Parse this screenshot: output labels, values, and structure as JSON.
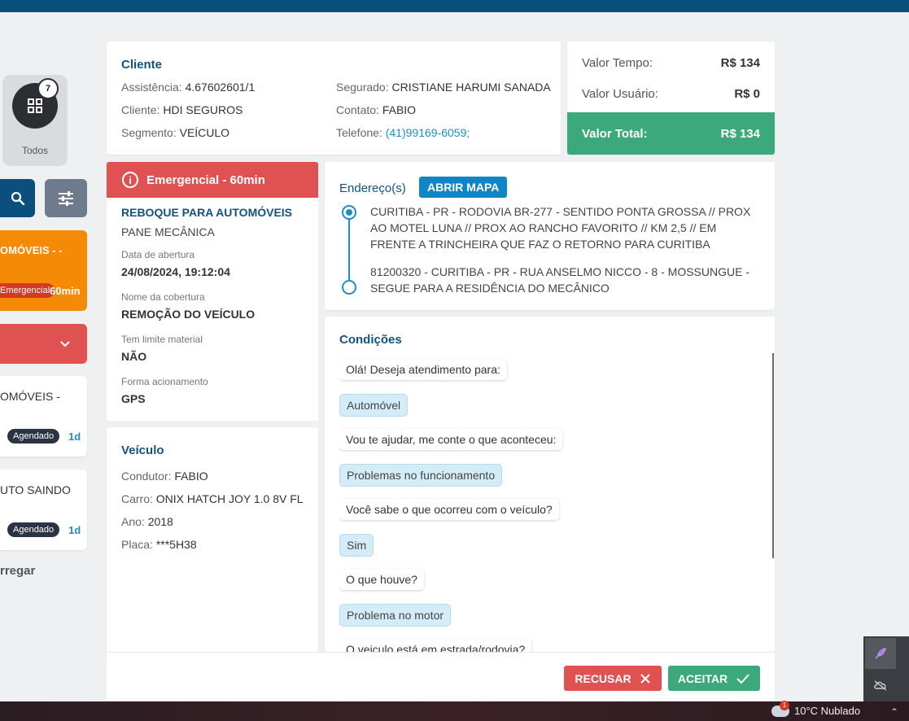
{
  "colors": {
    "primary": "#0b4f7e",
    "accent": "#1d8fc6",
    "danger": "#e05252",
    "success": "#3ba97b",
    "warning": "#f58a07"
  },
  "sidebar": {
    "todos": {
      "count": "7",
      "label": "Todos"
    },
    "items": [
      {
        "title": "OMÓVEIS - -",
        "badge": "Emergencial",
        "time": "60min"
      },
      {
        "title": "OMÓVEIS -",
        "badge": "Agendado",
        "time": "1d"
      },
      {
        "title": "UTO SAINDO",
        "badge": "Agendado",
        "time": "1d"
      }
    ],
    "load_more": "rregar"
  },
  "cliente": {
    "title": "Cliente",
    "assistencia_label": "Assistência:",
    "assistencia": "4.67602601/1",
    "cliente_label": "Cliente:",
    "cliente": "HDI SEGUROS",
    "segmento_label": "Segmento:",
    "segmento": "VEÍCULO",
    "segurado_label": "Segurado:",
    "segurado": "CRISTIANE HARUMI SANADA",
    "contato_label": "Contato:",
    "contato": "FABIO",
    "telefone_label": "Telefone:",
    "telefone": "(41)99169-6059;"
  },
  "valores": {
    "tempo_label": "Valor Tempo:",
    "tempo": "R$ 134",
    "usuario_label": "Valor Usuário:",
    "usuario": "R$ 0",
    "total_label": "Valor Total:",
    "total": "R$ 134"
  },
  "servico": {
    "emergencia": "Emergencial - 60min",
    "nome": "REBOQUE PARA AUTOMÓVEIS",
    "sub": "PANE MECÂNICA",
    "abertura_label": "Data de abertura",
    "abertura": "24/08/2024, 19:12:04",
    "cobertura_label": "Nome da cobertura",
    "cobertura": "REMOÇÃO DO VEÍCULO",
    "limite_label": "Tem limite material",
    "limite": "NÃO",
    "acionamento_label": "Forma acionamento",
    "acionamento": "GPS"
  },
  "veiculo": {
    "title": "Veículo",
    "condutor_label": "Condutor:",
    "condutor": "FABIO",
    "carro_label": "Carro:",
    "carro": "ONIX HATCH JOY 1.0 8V FL",
    "ano_label": "Ano:",
    "ano": "2018",
    "placa_label": "Placa:",
    "placa": "***5H38"
  },
  "enderecos": {
    "title": "Endereço(s)",
    "map_button": "ABRIR MAPA",
    "origem": "CURITIBA - PR - RODOVIA BR-277 - SENTIDO PONTA GROSSA // PROX AO MOTEL LUNA // PROX AO RANCHO FAVORITO // KM 2,5 // EM FRENTE A TRINCHEIRA QUE FAZ O RETORNO PARA CURITIBA",
    "destino": "81200320 - CURITIBA - PR - RUA ANSELMO NICCO - 8 - MOSSUNGUE - SEGUE PARA A RESIDÊNCIA DO MECÂNICO"
  },
  "condicoes": {
    "title": "Condições",
    "messages": [
      "Olá! Deseja atendimento para:",
      "Automóvel",
      "Vou te ajudar, me conte o que aconteceu:",
      "Problemas no funcionamento",
      "Você sabe o que ocorreu com o veículo?",
      "Sim",
      "O que houve?",
      "Problema no motor",
      "O veiculo está em estrada/rodovia?"
    ]
  },
  "actions": {
    "recusar": "RECUSAR",
    "aceitar": "ACEITAR"
  },
  "taskbar": {
    "weather": "10°C Nublado",
    "weather_badge": "1"
  }
}
